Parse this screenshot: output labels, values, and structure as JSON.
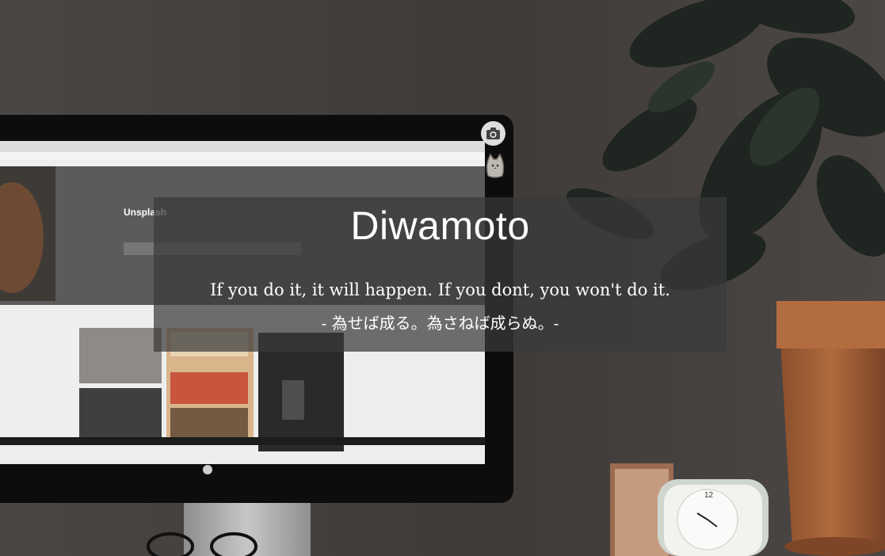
{
  "title": "Diwamoto",
  "quote_en": "If you do it, it will happen. If you dont, you won't do it.",
  "quote_jp": "- 為せば成る。為さねば成らぬ。-",
  "monitor_screen": {
    "brand": "Unsplash"
  },
  "icons": {
    "camera": "camera-icon",
    "cat": "cat-sticker-icon"
  },
  "colors": {
    "overlay_bg": "#3a3a3a",
    "text": "#ffffff"
  }
}
